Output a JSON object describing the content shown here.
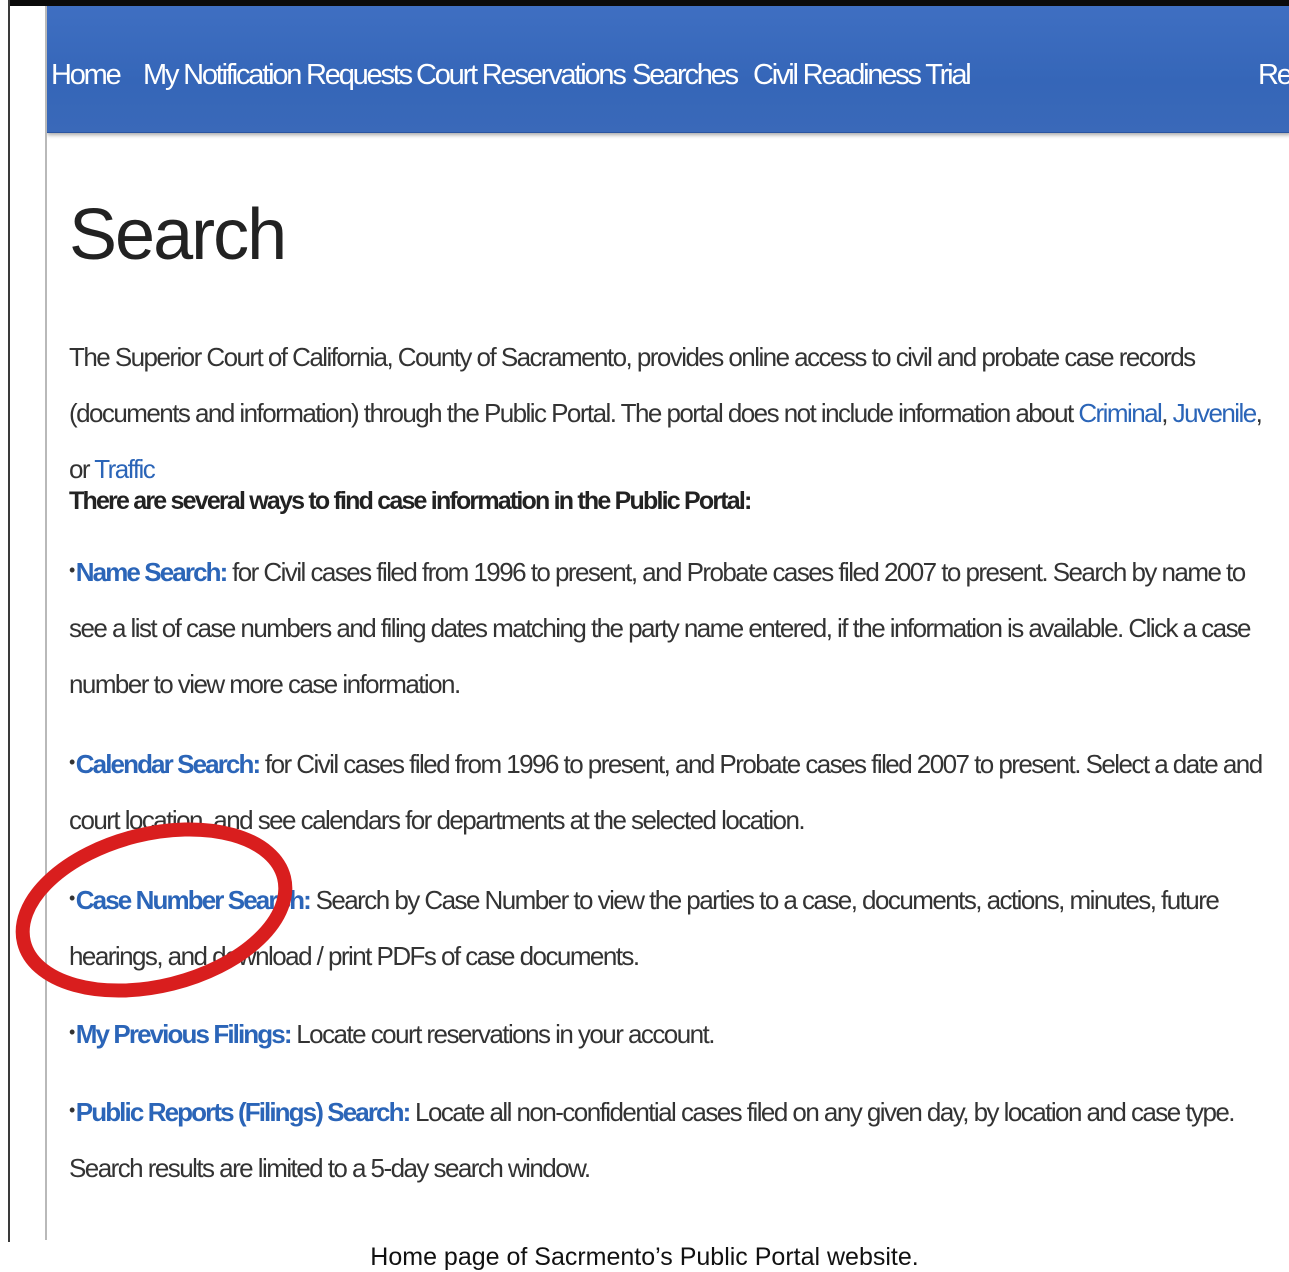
{
  "nav": {
    "items": [
      {
        "label": "Home"
      },
      {
        "label": "My Notification Requests"
      },
      {
        "label": "Court Reservations"
      },
      {
        "label": "Searches"
      },
      {
        "label": "Civil Readiness Trial"
      },
      {
        "label": "Ret"
      }
    ]
  },
  "page": {
    "title": "Search",
    "intro": {
      "text1": "The Superior Court of California, County of Sacramento, provides online access to civil and probate case records (documents and information) through the Public Portal. The portal does not include information about ",
      "link_criminal": "Criminal",
      "sep1": ", ",
      "link_juvenile": "Juvenile",
      "sep2": ", or ",
      "link_traffic": "Traffic"
    },
    "ways_heading": "There are several ways to find case information in the Public Portal:",
    "bullets": [
      {
        "dot": "•",
        "link": "Name Search:",
        "text": " for Civil cases filed from 1996 to present, and Probate cases filed 2007 to present. Search by name to see a list of case numbers and filing dates matching the party name entered, if the information is available. Click a case number to view more case information."
      },
      {
        "dot": "•",
        "link": "Calendar Search:",
        "text": " for Civil cases filed from 1996 to present, and Probate cases filed 2007 to present. Select a date and court location, and see calendars for departments at the selected location."
      },
      {
        "dot": "•",
        "link": "Case Number Search:",
        "text": " Search by Case Number to view the parties to a case, documents, actions, minutes, future hearings, and download / print PDFs of case documents."
      },
      {
        "dot": "•",
        "link": "My Previous Filings:",
        "text": " Locate court reservations in your account."
      },
      {
        "dot": "•",
        "link": "Public Reports (Filings) Search:",
        "text": " Locate all non-confidential cases filed on any given day, by location and case type. Search results are limited to a 5-day search window."
      }
    ]
  },
  "caption": "Home page of Sacrmento’s Public Portal website.",
  "colors": {
    "nav_bg": "#3566b8",
    "link": "#2b65b8",
    "highlight_circle": "#d91e1e"
  }
}
